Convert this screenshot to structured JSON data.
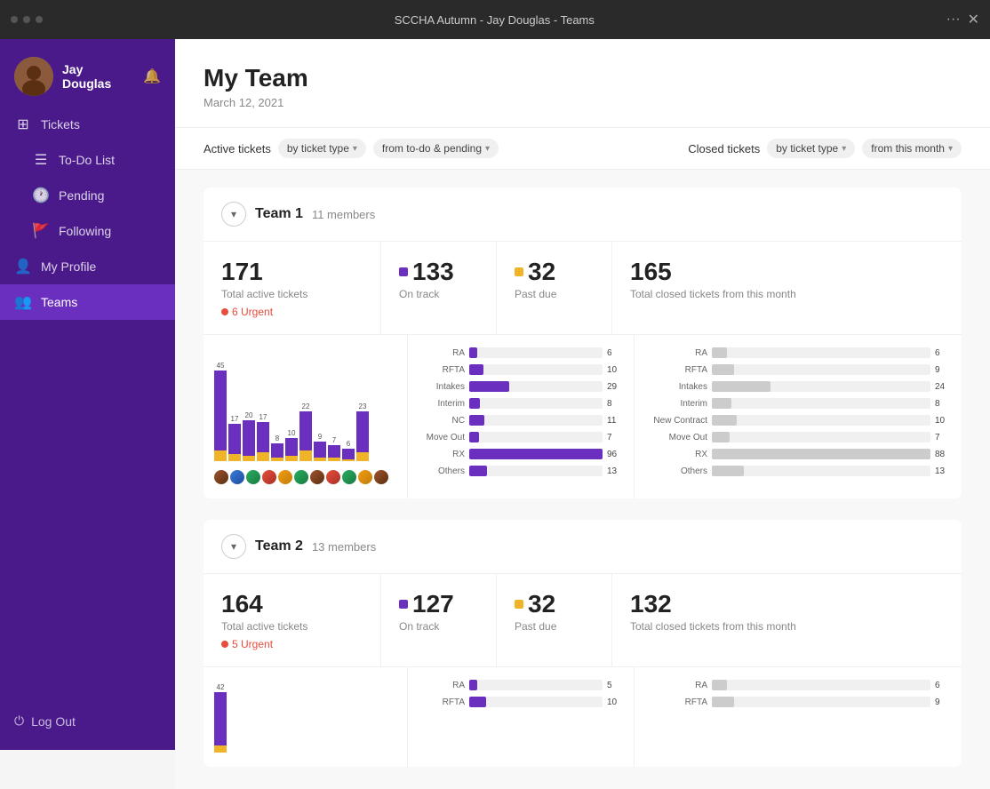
{
  "browser": {
    "title": "SCCHA Autumn - Jay Douglas - Teams",
    "dots": [
      "dot1",
      "dot2",
      "dot3"
    ]
  },
  "sidebar": {
    "user": {
      "name": "Jay Douglas"
    },
    "nav": {
      "tickets_label": "Tickets",
      "todo_label": "To-Do List",
      "pending_label": "Pending",
      "following_label": "Following",
      "profile_label": "My Profile",
      "teams_label": "Teams",
      "logout_label": "Log Out"
    }
  },
  "page": {
    "title": "My Team",
    "date": "March 12, 2021"
  },
  "filters": {
    "active_label": "Active tickets",
    "by_type_label": "by ticket type",
    "from_label": "from to-do & pending",
    "closed_label": "Closed tickets",
    "closed_by_type": "by ticket type",
    "closed_from": "from this month"
  },
  "team1": {
    "name": "Team 1",
    "members": "11 members",
    "total_active": "171",
    "total_active_label": "Total active tickets",
    "urgent_count": "6 Urgent",
    "on_track": "133",
    "on_track_label": "On track",
    "past_due": "32",
    "past_due_label": "Past due",
    "total_closed": "165",
    "total_closed_label": "Total closed tickets from this month",
    "bars": [
      {
        "val": 45,
        "yellow": 8
      },
      {
        "val": 17,
        "yellow": 4
      },
      {
        "val": 20,
        "yellow": 3
      },
      {
        "val": 17,
        "yellow": 5
      },
      {
        "val": 8,
        "yellow": 2
      },
      {
        "val": 10,
        "yellow": 3
      },
      {
        "val": 22,
        "yellow": 6
      },
      {
        "val": 9,
        "yellow": 2
      },
      {
        "val": 7,
        "yellow": 2
      },
      {
        "val": 6,
        "yellow": 1
      },
      {
        "val": 23,
        "yellow": 5
      }
    ],
    "active_by_type": [
      {
        "label": "RA",
        "val": 6,
        "max": 96
      },
      {
        "label": "RFTA",
        "val": 10,
        "max": 96
      },
      {
        "label": "Intakes",
        "val": 29,
        "max": 96
      },
      {
        "label": "Interim",
        "val": 8,
        "max": 96
      },
      {
        "label": "NC",
        "val": 11,
        "max": 96
      },
      {
        "label": "Move Out",
        "val": 7,
        "max": 96
      },
      {
        "label": "RX",
        "val": 96,
        "max": 96
      },
      {
        "label": "Others",
        "val": 13,
        "max": 96
      }
    ],
    "closed_by_type": [
      {
        "label": "RA",
        "val": 6,
        "max": 88
      },
      {
        "label": "RFTA",
        "val": 9,
        "max": 88
      },
      {
        "label": "Intakes",
        "val": 24,
        "max": 88
      },
      {
        "label": "Interim",
        "val": 8,
        "max": 88
      },
      {
        "label": "New Contract",
        "val": 10,
        "max": 88
      },
      {
        "label": "Move Out",
        "val": 7,
        "max": 88
      },
      {
        "label": "RX",
        "val": 88,
        "max": 88
      },
      {
        "label": "Others",
        "val": 13,
        "max": 88
      }
    ]
  },
  "team2": {
    "name": "Team 2",
    "members": "13 members",
    "total_active": "164",
    "total_active_label": "Total active tickets",
    "urgent_count": "5 Urgent",
    "on_track": "127",
    "on_track_label": "On track",
    "past_due": "32",
    "past_due_label": "Past due",
    "total_closed": "132",
    "total_closed_label": "Total closed tickets from this month",
    "bars": [
      {
        "val": 42,
        "yellow": 7
      }
    ],
    "active_by_type": [
      {
        "label": "RA",
        "val": 5,
        "max": 80
      },
      {
        "label": "RFTA",
        "val": 10,
        "max": 80
      }
    ],
    "closed_by_type": [
      {
        "label": "RA",
        "val": 6,
        "max": 80
      },
      {
        "label": "RFTA",
        "val": 9,
        "max": 80
      }
    ]
  }
}
